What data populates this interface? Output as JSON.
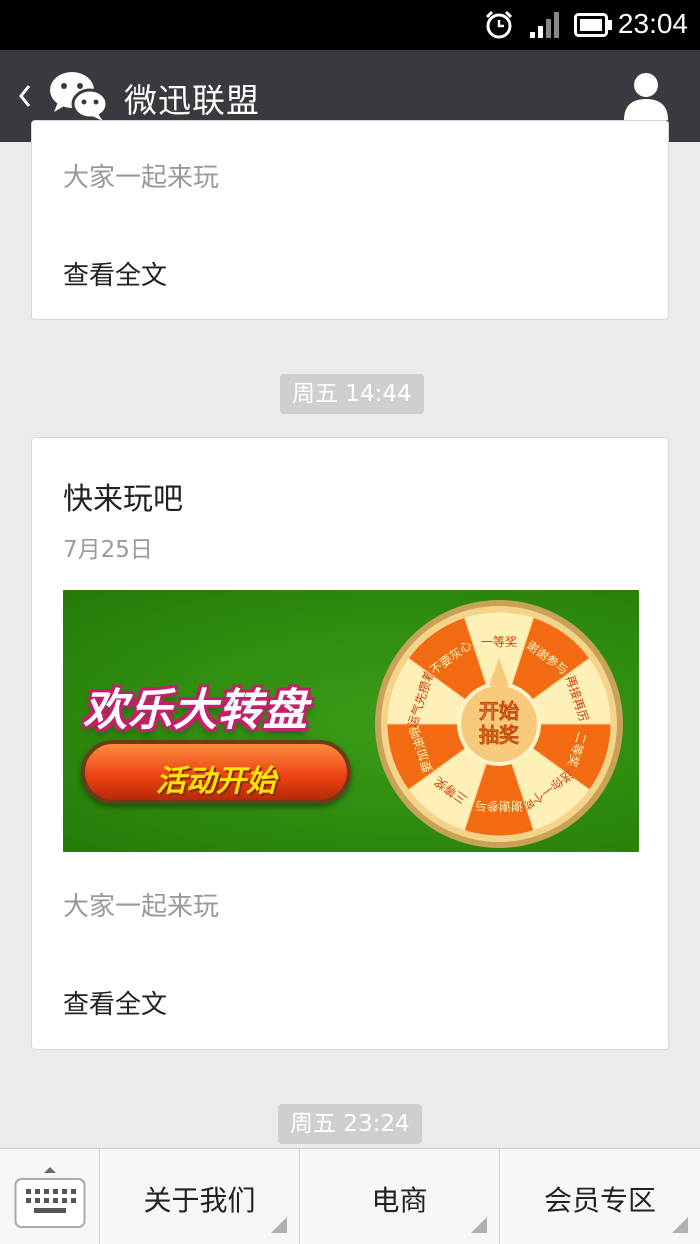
{
  "status_bar": {
    "time": "23:04",
    "icons": [
      "alarm-icon",
      "signal-icon",
      "battery-icon"
    ]
  },
  "title_bar": {
    "title": "微迅联盟",
    "icons": [
      "back-icon",
      "wechat-logo-icon",
      "profile-icon"
    ]
  },
  "feed": {
    "card1": {
      "digest": "大家一起来玩",
      "read_more": "查看全文"
    },
    "timestamp1": "周五 14:44",
    "card2": {
      "title": "快来玩吧",
      "date": "7月25日",
      "banner": {
        "headline": "欢乐大转盘",
        "button": "活动开始",
        "wheel_center": [
          "开始",
          "抽奖"
        ],
        "prizes": [
          "一等奖",
          "谢谢参与",
          "再接再厉",
          "二等奖",
          "送你一个吻",
          "谢谢参与",
          "三等奖",
          "要加油哦",
          "运气先攒着",
          "不要灰心"
        ]
      },
      "digest": "大家一起来玩",
      "read_more": "查看全文"
    },
    "timestamp2": "周五 23:24"
  },
  "menu": {
    "keyboard_icon": "keyboard-icon",
    "items": [
      "关于我们",
      "电商",
      "会员专区"
    ]
  },
  "colors": {
    "titlebar": "#393a3f",
    "background": "#ebebeb",
    "banner_green": "#2f8c0f",
    "wheel_orange": "#f26a12"
  }
}
